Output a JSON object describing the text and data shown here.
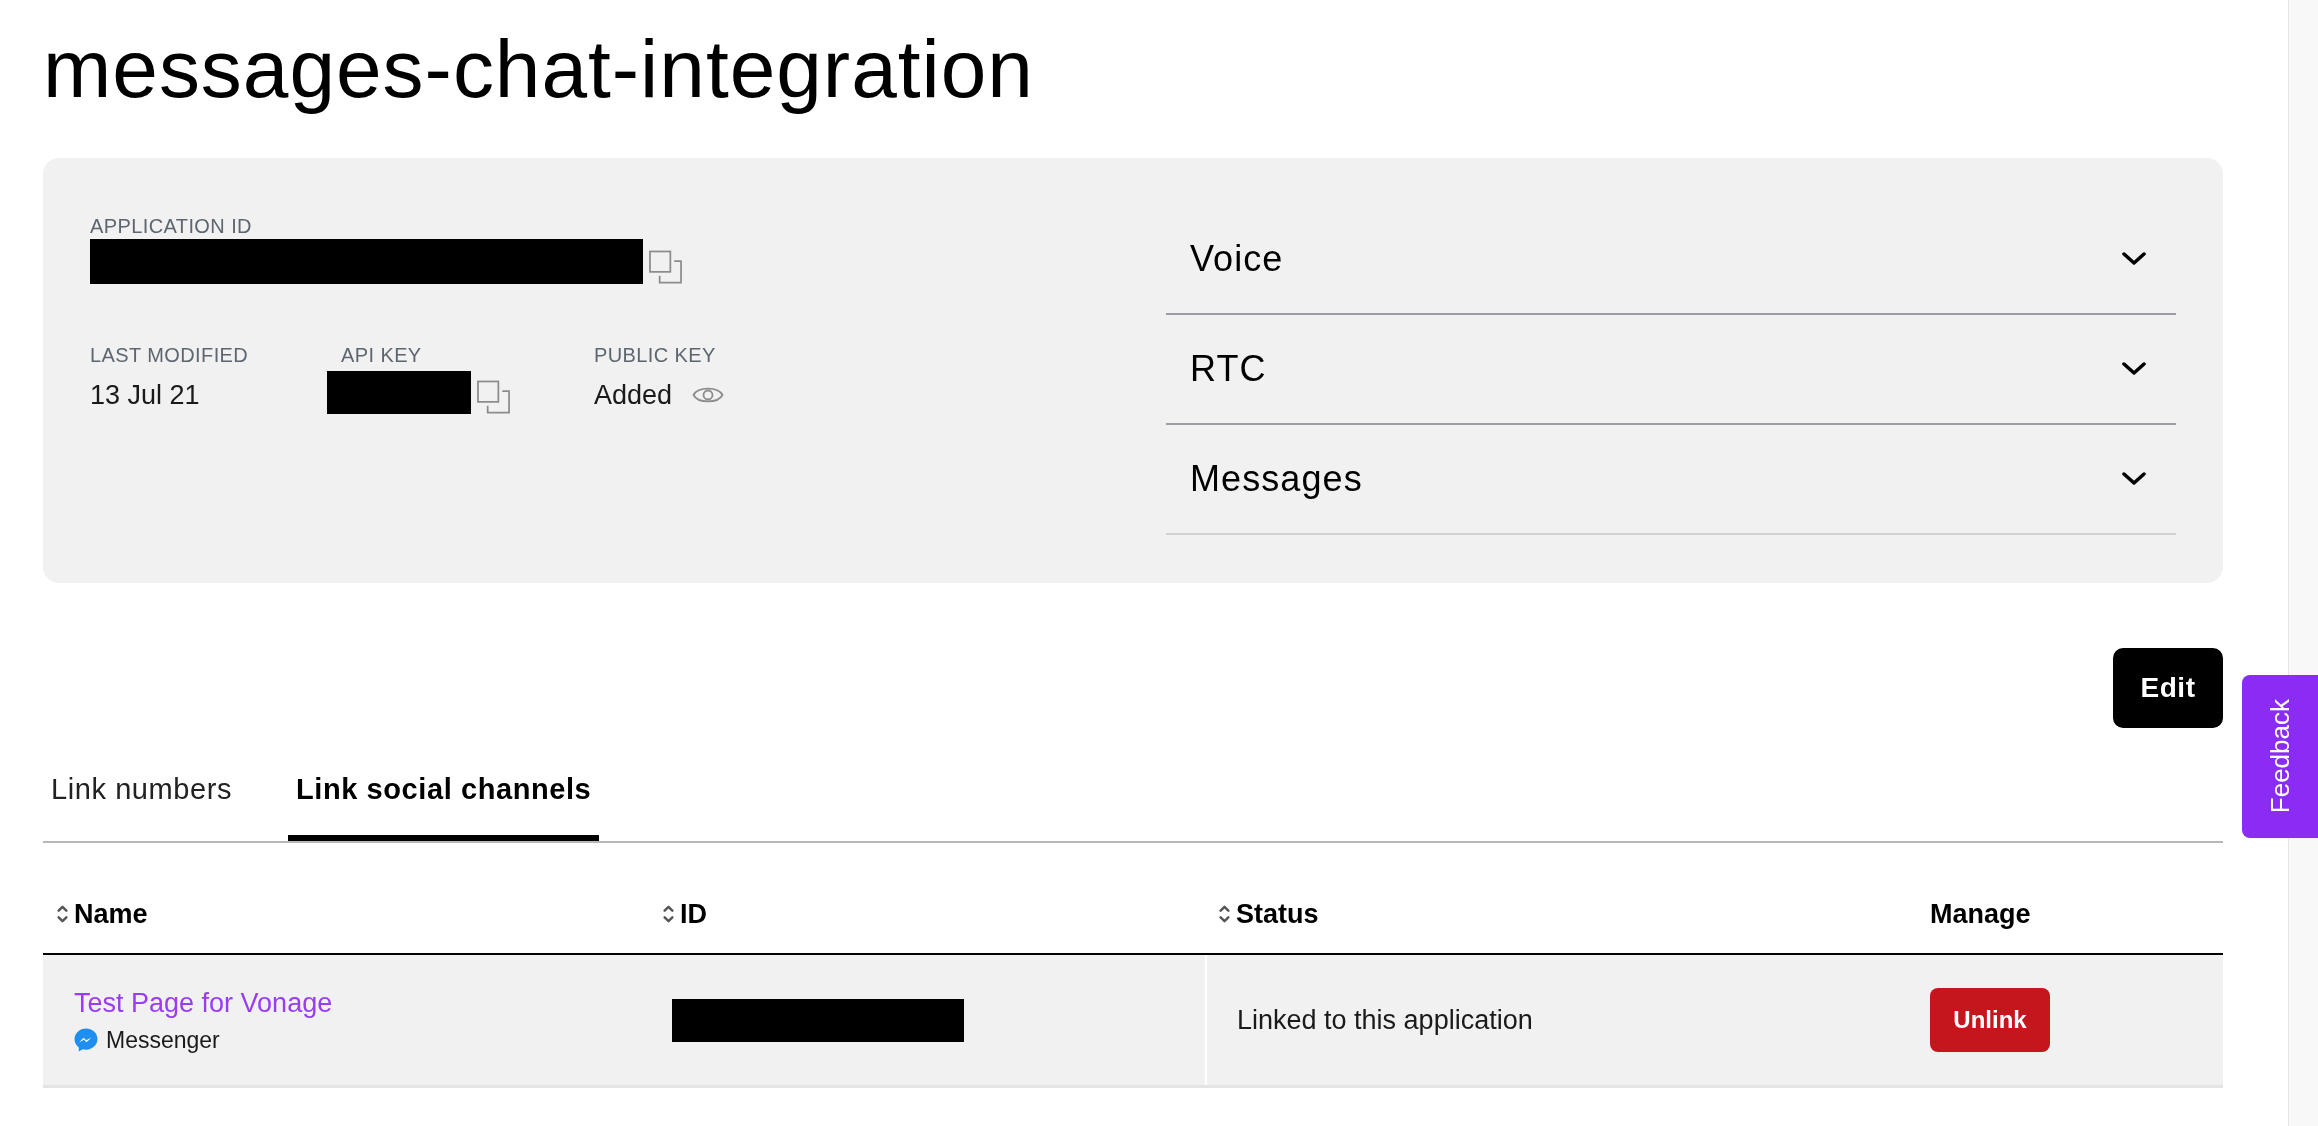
{
  "page_title": "messages-chat-integration",
  "application": {
    "id_field": {
      "label": "APPLICATION ID",
      "kind": "redacted"
    },
    "details": [
      {
        "label": "LAST MODIFIED",
        "kind": "text",
        "value": "13 Jul 21"
      },
      {
        "label": "API KEY",
        "kind": "redacted"
      },
      {
        "label": "PUBLIC KEY",
        "kind": "reveal",
        "value": "Added"
      }
    ]
  },
  "capabilities": [
    {
      "label": "Voice",
      "expanded": false
    },
    {
      "label": "RTC",
      "expanded": false
    },
    {
      "label": "Messages",
      "expanded": false
    }
  ],
  "edit_button": "Edit",
  "tabs": [
    {
      "label": "Link numbers",
      "selected": false
    },
    {
      "label": "Link social channels",
      "selected": true
    }
  ],
  "table": {
    "columns": [
      {
        "label": "Name",
        "sortable": true
      },
      {
        "label": "ID",
        "sortable": true
      },
      {
        "label": "Status",
        "sortable": true
      },
      {
        "label": "Manage",
        "sortable": false
      }
    ],
    "rows": [
      {
        "name": "Test Page for Vonage",
        "channel": "Messenger",
        "status": "Linked to this application",
        "action": "Unlink"
      }
    ]
  },
  "feedback_button": "Feedback"
}
